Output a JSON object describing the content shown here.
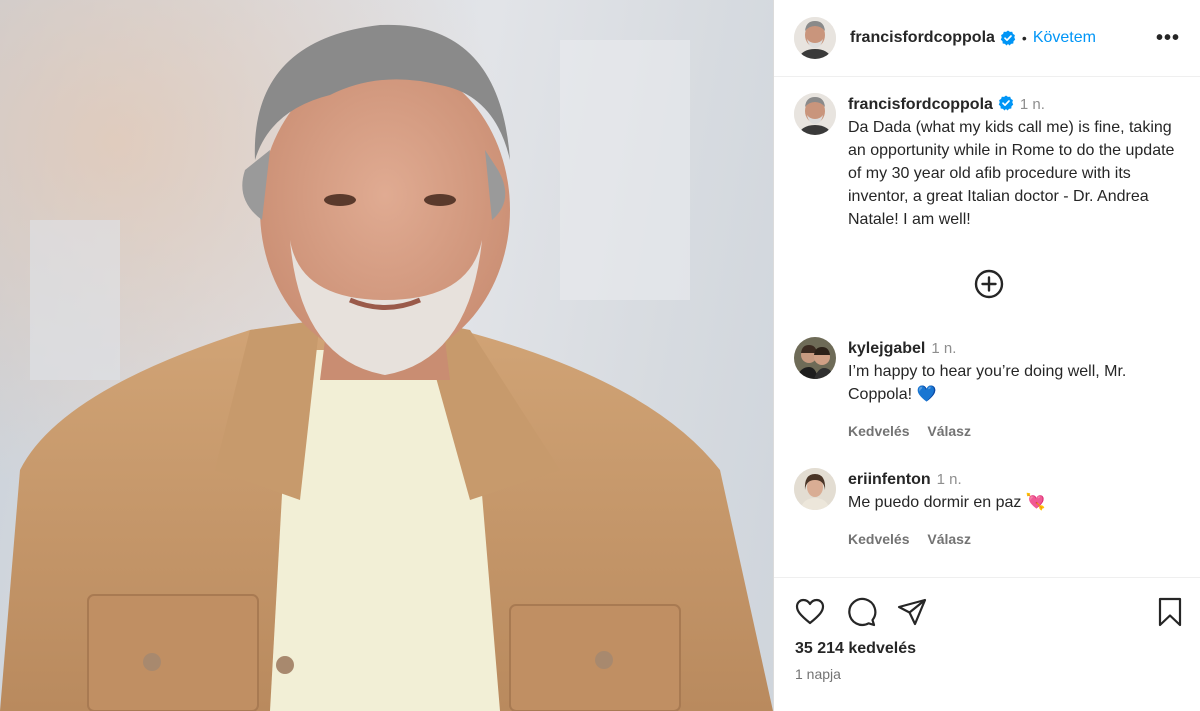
{
  "header": {
    "username": "francisfordcoppola",
    "separator": "•",
    "follow_label": "Követem",
    "more_label": "•••"
  },
  "caption": {
    "username": "francisfordcoppola",
    "time": "1 n.",
    "text": "Da Dada (what my kids call me) is fine, taking an opportunity while in Rome to do the update of my 30 year old afib procedure with its inventor, a great Italian doctor - Dr. Andrea Natale! I am well!"
  },
  "comments": [
    {
      "username": "kylejgabel",
      "time": "1 n.",
      "text": "I’m happy to hear you’re doing well, Mr. Coppola! 💙",
      "like_label": "Kedvelés",
      "reply_label": "Válasz"
    },
    {
      "username": "eriinfenton",
      "time": "1 n.",
      "text": "Me puedo dormir en paz 💘",
      "like_label": "Kedvelés",
      "reply_label": "Válasz"
    }
  ],
  "footer": {
    "likes": "35 214 kedvelés",
    "date": "1 napja"
  },
  "icons": {
    "verified": "verified-badge-icon",
    "load_more": "plus-circle-icon",
    "like": "heart-icon",
    "comment": "comment-bubble-icon",
    "share": "paper-plane-icon",
    "save": "bookmark-icon"
  },
  "colors": {
    "accent": "#0095f6",
    "verified": "#0095f6",
    "jacket": "#c8996b"
  }
}
